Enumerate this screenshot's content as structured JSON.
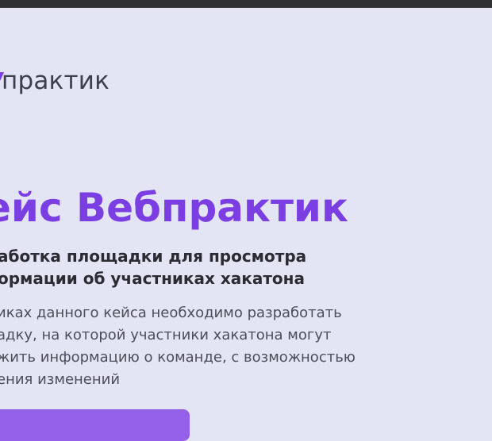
{
  "header": {
    "logo_text": "практик"
  },
  "hero": {
    "title": "ейс Вебпрактик",
    "subtitle_lines": [
      "аботка площадки для просмотра",
      "ормации об участниках хакатона"
    ],
    "description_lines": [
      "иках данного кейса необходимо разработать",
      "адку, на которой участники хакатона могут",
      "жить информацию о команде, с возможностью",
      "ения изменений"
    ]
  },
  "colors": {
    "accent": "#7b3ee3",
    "background": "#e3e4f4",
    "button": "#9561ea"
  }
}
